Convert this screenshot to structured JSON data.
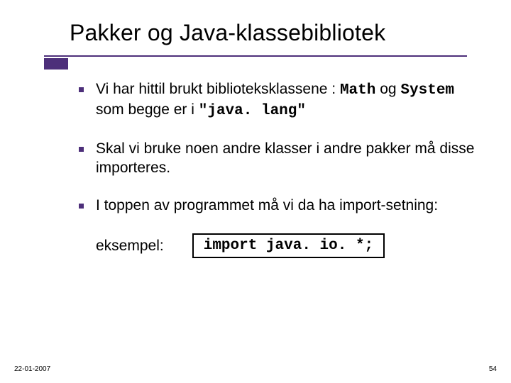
{
  "slide": {
    "title": "Pakker og Java-klassebibliotek",
    "bullets": [
      {
        "prefix": "Vi har hittil brukt biblioteksklassene : ",
        "code1": "Math",
        "mid": " og ",
        "code2": "System",
        "mid2": " som begge er i ",
        "code3": "\"java. lang\""
      },
      {
        "text": "Skal vi bruke noen andre klasser i andre pakker må disse importeres."
      },
      {
        "text": "I toppen av programmet må vi da ha import-setning:"
      }
    ],
    "example_label": "eksempel:",
    "example_code": "import java. io. *;"
  },
  "footer": {
    "date": "22-01-2007",
    "page": "54"
  }
}
